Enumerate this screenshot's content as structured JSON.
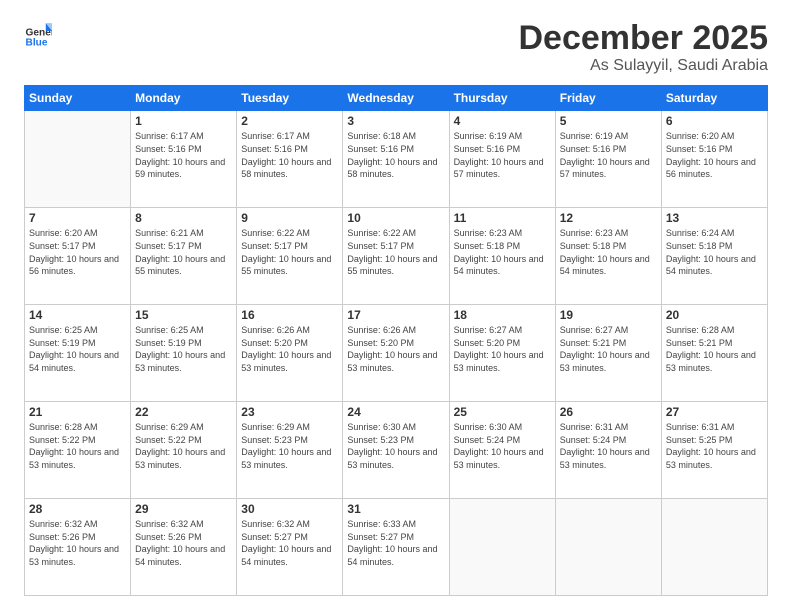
{
  "logo": {
    "text_general": "General",
    "text_blue": "Blue"
  },
  "header": {
    "month": "December 2025",
    "location": "As Sulayyil, Saudi Arabia"
  },
  "days_of_week": [
    "Sunday",
    "Monday",
    "Tuesday",
    "Wednesday",
    "Thursday",
    "Friday",
    "Saturday"
  ],
  "weeks": [
    [
      {
        "day": "",
        "sunrise": "",
        "sunset": "",
        "daylight": ""
      },
      {
        "day": "1",
        "sunrise": "Sunrise: 6:17 AM",
        "sunset": "Sunset: 5:16 PM",
        "daylight": "Daylight: 10 hours and 59 minutes."
      },
      {
        "day": "2",
        "sunrise": "Sunrise: 6:17 AM",
        "sunset": "Sunset: 5:16 PM",
        "daylight": "Daylight: 10 hours and 58 minutes."
      },
      {
        "day": "3",
        "sunrise": "Sunrise: 6:18 AM",
        "sunset": "Sunset: 5:16 PM",
        "daylight": "Daylight: 10 hours and 58 minutes."
      },
      {
        "day": "4",
        "sunrise": "Sunrise: 6:19 AM",
        "sunset": "Sunset: 5:16 PM",
        "daylight": "Daylight: 10 hours and 57 minutes."
      },
      {
        "day": "5",
        "sunrise": "Sunrise: 6:19 AM",
        "sunset": "Sunset: 5:16 PM",
        "daylight": "Daylight: 10 hours and 57 minutes."
      },
      {
        "day": "6",
        "sunrise": "Sunrise: 6:20 AM",
        "sunset": "Sunset: 5:16 PM",
        "daylight": "Daylight: 10 hours and 56 minutes."
      }
    ],
    [
      {
        "day": "7",
        "sunrise": "Sunrise: 6:20 AM",
        "sunset": "Sunset: 5:17 PM",
        "daylight": "Daylight: 10 hours and 56 minutes."
      },
      {
        "day": "8",
        "sunrise": "Sunrise: 6:21 AM",
        "sunset": "Sunset: 5:17 PM",
        "daylight": "Daylight: 10 hours and 55 minutes."
      },
      {
        "day": "9",
        "sunrise": "Sunrise: 6:22 AM",
        "sunset": "Sunset: 5:17 PM",
        "daylight": "Daylight: 10 hours and 55 minutes."
      },
      {
        "day": "10",
        "sunrise": "Sunrise: 6:22 AM",
        "sunset": "Sunset: 5:17 PM",
        "daylight": "Daylight: 10 hours and 55 minutes."
      },
      {
        "day": "11",
        "sunrise": "Sunrise: 6:23 AM",
        "sunset": "Sunset: 5:18 PM",
        "daylight": "Daylight: 10 hours and 54 minutes."
      },
      {
        "day": "12",
        "sunrise": "Sunrise: 6:23 AM",
        "sunset": "Sunset: 5:18 PM",
        "daylight": "Daylight: 10 hours and 54 minutes."
      },
      {
        "day": "13",
        "sunrise": "Sunrise: 6:24 AM",
        "sunset": "Sunset: 5:18 PM",
        "daylight": "Daylight: 10 hours and 54 minutes."
      }
    ],
    [
      {
        "day": "14",
        "sunrise": "Sunrise: 6:25 AM",
        "sunset": "Sunset: 5:19 PM",
        "daylight": "Daylight: 10 hours and 54 minutes."
      },
      {
        "day": "15",
        "sunrise": "Sunrise: 6:25 AM",
        "sunset": "Sunset: 5:19 PM",
        "daylight": "Daylight: 10 hours and 53 minutes."
      },
      {
        "day": "16",
        "sunrise": "Sunrise: 6:26 AM",
        "sunset": "Sunset: 5:20 PM",
        "daylight": "Daylight: 10 hours and 53 minutes."
      },
      {
        "day": "17",
        "sunrise": "Sunrise: 6:26 AM",
        "sunset": "Sunset: 5:20 PM",
        "daylight": "Daylight: 10 hours and 53 minutes."
      },
      {
        "day": "18",
        "sunrise": "Sunrise: 6:27 AM",
        "sunset": "Sunset: 5:20 PM",
        "daylight": "Daylight: 10 hours and 53 minutes."
      },
      {
        "day": "19",
        "sunrise": "Sunrise: 6:27 AM",
        "sunset": "Sunset: 5:21 PM",
        "daylight": "Daylight: 10 hours and 53 minutes."
      },
      {
        "day": "20",
        "sunrise": "Sunrise: 6:28 AM",
        "sunset": "Sunset: 5:21 PM",
        "daylight": "Daylight: 10 hours and 53 minutes."
      }
    ],
    [
      {
        "day": "21",
        "sunrise": "Sunrise: 6:28 AM",
        "sunset": "Sunset: 5:22 PM",
        "daylight": "Daylight: 10 hours and 53 minutes."
      },
      {
        "day": "22",
        "sunrise": "Sunrise: 6:29 AM",
        "sunset": "Sunset: 5:22 PM",
        "daylight": "Daylight: 10 hours and 53 minutes."
      },
      {
        "day": "23",
        "sunrise": "Sunrise: 6:29 AM",
        "sunset": "Sunset: 5:23 PM",
        "daylight": "Daylight: 10 hours and 53 minutes."
      },
      {
        "day": "24",
        "sunrise": "Sunrise: 6:30 AM",
        "sunset": "Sunset: 5:23 PM",
        "daylight": "Daylight: 10 hours and 53 minutes."
      },
      {
        "day": "25",
        "sunrise": "Sunrise: 6:30 AM",
        "sunset": "Sunset: 5:24 PM",
        "daylight": "Daylight: 10 hours and 53 minutes."
      },
      {
        "day": "26",
        "sunrise": "Sunrise: 6:31 AM",
        "sunset": "Sunset: 5:24 PM",
        "daylight": "Daylight: 10 hours and 53 minutes."
      },
      {
        "day": "27",
        "sunrise": "Sunrise: 6:31 AM",
        "sunset": "Sunset: 5:25 PM",
        "daylight": "Daylight: 10 hours and 53 minutes."
      }
    ],
    [
      {
        "day": "28",
        "sunrise": "Sunrise: 6:32 AM",
        "sunset": "Sunset: 5:26 PM",
        "daylight": "Daylight: 10 hours and 53 minutes."
      },
      {
        "day": "29",
        "sunrise": "Sunrise: 6:32 AM",
        "sunset": "Sunset: 5:26 PM",
        "daylight": "Daylight: 10 hours and 54 minutes."
      },
      {
        "day": "30",
        "sunrise": "Sunrise: 6:32 AM",
        "sunset": "Sunset: 5:27 PM",
        "daylight": "Daylight: 10 hours and 54 minutes."
      },
      {
        "day": "31",
        "sunrise": "Sunrise: 6:33 AM",
        "sunset": "Sunset: 5:27 PM",
        "daylight": "Daylight: 10 hours and 54 minutes."
      },
      {
        "day": "",
        "sunrise": "",
        "sunset": "",
        "daylight": ""
      },
      {
        "day": "",
        "sunrise": "",
        "sunset": "",
        "daylight": ""
      },
      {
        "day": "",
        "sunrise": "",
        "sunset": "",
        "daylight": ""
      }
    ]
  ]
}
